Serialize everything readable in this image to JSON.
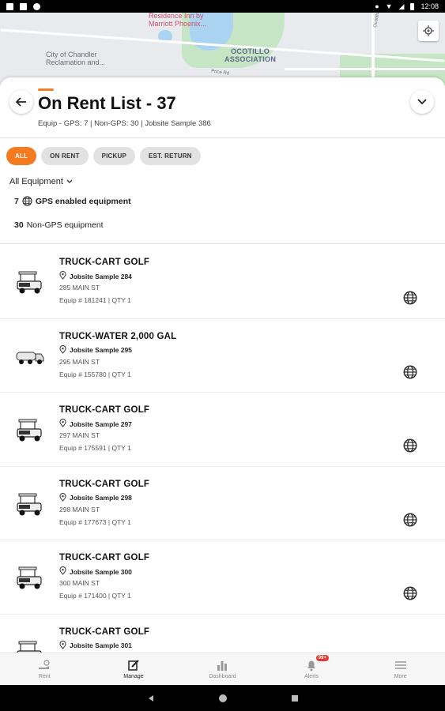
{
  "status_bar": {
    "time": "12:08"
  },
  "map": {
    "labels": {
      "poi": "Residence Inn by\nMarriott Phoenix...",
      "reclamation": "City of Chandler\nReclamation and...",
      "association": "OCOTILLO\nASSOCIATION",
      "road": "Price Rd",
      "road2": "Ocotillo Dr"
    }
  },
  "header": {
    "title": "On Rent List - 37",
    "subtitle": "Equip - GPS: 7 | Non-GPS: 30 | Jobsite Sample 386"
  },
  "filters": {
    "chips": [
      "ALL",
      "ON RENT",
      "PICKUP",
      "EST. RETURN"
    ],
    "active": "ALL"
  },
  "equipment_filter": {
    "selected": "All Equipment"
  },
  "counts": {
    "gps_count": "7",
    "gps_label": "GPS enabled equipment",
    "non_gps_count": "30",
    "non_gps_label": "Non-GPS equipment"
  },
  "items": [
    {
      "name": "TRUCK-CART GOLF",
      "jobsite": "Jobsite Sample 284",
      "address": "285 MAIN ST",
      "equip": "Equip # 181241 | QTY 1",
      "icon": "golf-cart-icon"
    },
    {
      "name": "TRUCK-WATER 2,000 GAL",
      "jobsite": "Jobsite Sample 295",
      "address": "295 MAIN ST",
      "equip": "Equip # 155780 | QTY 1",
      "icon": "water-truck-icon"
    },
    {
      "name": "TRUCK-CART GOLF",
      "jobsite": "Jobsite Sample 297",
      "address": "297 MAIN ST",
      "equip": "Equip # 175591 | QTY 1",
      "icon": "golf-cart-icon"
    },
    {
      "name": "TRUCK-CART GOLF",
      "jobsite": "Jobsite Sample 298",
      "address": "298 MAIN ST",
      "equip": "Equip # 177673 | QTY 1",
      "icon": "golf-cart-icon"
    },
    {
      "name": "TRUCK-CART GOLF",
      "jobsite": "Jobsite Sample 300",
      "address": "300 MAIN ST",
      "equip": "Equip # 171400 | QTY 1",
      "icon": "golf-cart-icon"
    },
    {
      "name": "TRUCK-CART GOLF",
      "jobsite": "Jobsite Sample 301",
      "address": "",
      "equip": "",
      "icon": "golf-cart-icon"
    }
  ],
  "bottom_nav": {
    "items": [
      "Rent",
      "Manage",
      "Dashboard",
      "Alerts",
      "More"
    ],
    "active": "Manage",
    "alerts_badge": "99+"
  },
  "colors": {
    "accent": "#f47b20"
  }
}
